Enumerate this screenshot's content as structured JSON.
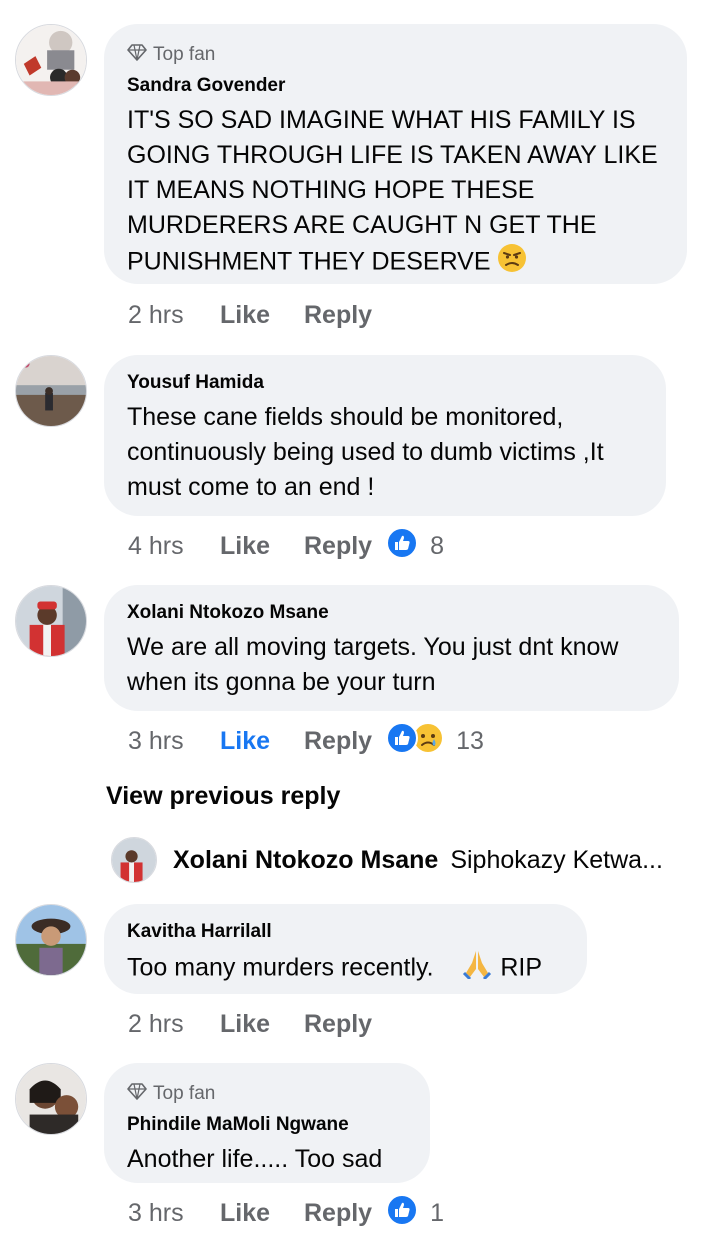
{
  "labels": {
    "like": "Like",
    "reply": "Reply",
    "top_fan": "Top fan"
  },
  "comments": [
    {
      "author": "Sandra Govender",
      "badge": "Top fan",
      "text": "IT'S SO SAD IMAGINE WHAT HIS FAMILY IS GOING THROUGH LIFE IS TAKEN AWAY LIKE IT MEANS NOTHING HOPE THESE MURDERERS ARE CAUGHT N GET THE PUNISHMENT THEY DESERVE",
      "emoji": "angry-face",
      "time": "2 hrs"
    },
    {
      "author": "Yousuf Hamida",
      "text": "These cane fields should be monitored, continuously being used to dumb victims ,It must come to an end !",
      "time": "4 hrs",
      "reaction_count": "8",
      "reactions": [
        "like"
      ]
    },
    {
      "author": "Xolani Ntokozo Msane",
      "text": "We are all moving targets. You just dnt know when its gonna be your turn",
      "time": "3 hrs",
      "reaction_count": "13",
      "reactions": [
        "like",
        "sad"
      ],
      "liked_by_viewer": true
    },
    {
      "author": "Kavitha Harrilall",
      "text": "Too many murders recently.",
      "text_suffix": "RIP",
      "emoji": "folded-hands",
      "time": "2 hrs"
    },
    {
      "author": "Phindile MaMoli Ngwane",
      "badge": "Top fan",
      "text": "Another life..... Too sad",
      "time": "3 hrs",
      "reaction_count": "1",
      "reactions": [
        "like"
      ]
    }
  ],
  "view_previous_reply": "View previous reply",
  "reply_preview": {
    "author": "Xolani Ntokozo Msane",
    "text": "Siphokazy Ketwa..."
  },
  "colors": {
    "bubble": "#f0f2f5",
    "link_blue": "#1877f2",
    "meta_gray": "#65676b"
  }
}
